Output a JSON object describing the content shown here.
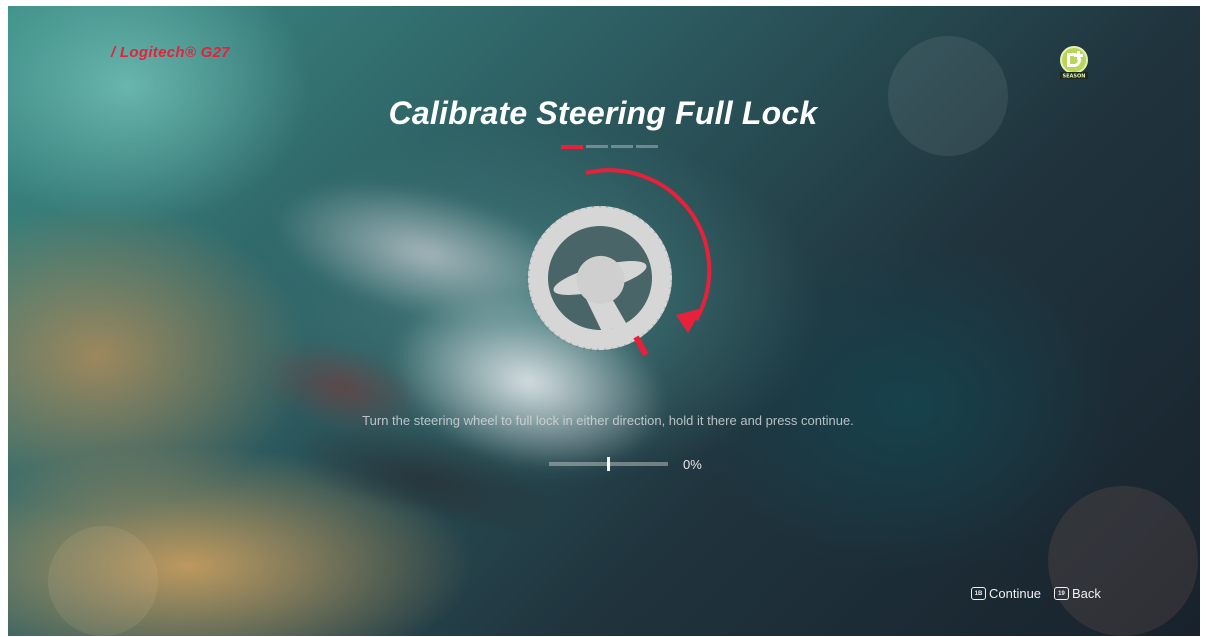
{
  "header": {
    "device_label": "/ Logitech® G27"
  },
  "badge": {
    "icon": "season-pass-icon",
    "text": "SEASON"
  },
  "main": {
    "title": "Calibrate Steering Full Lock",
    "steps_total": 4,
    "active_step": 1,
    "instruction": "Turn the steering wheel to full lock in either direction, hold it there and press continue.",
    "progress_percent_label": "0%"
  },
  "footer": {
    "continue": {
      "key_label": "1B",
      "label": "Continue"
    },
    "back": {
      "key_label": "19",
      "label": "Back"
    }
  },
  "colors": {
    "accent": "#e8203a",
    "badge_green": "#b7d65a"
  }
}
